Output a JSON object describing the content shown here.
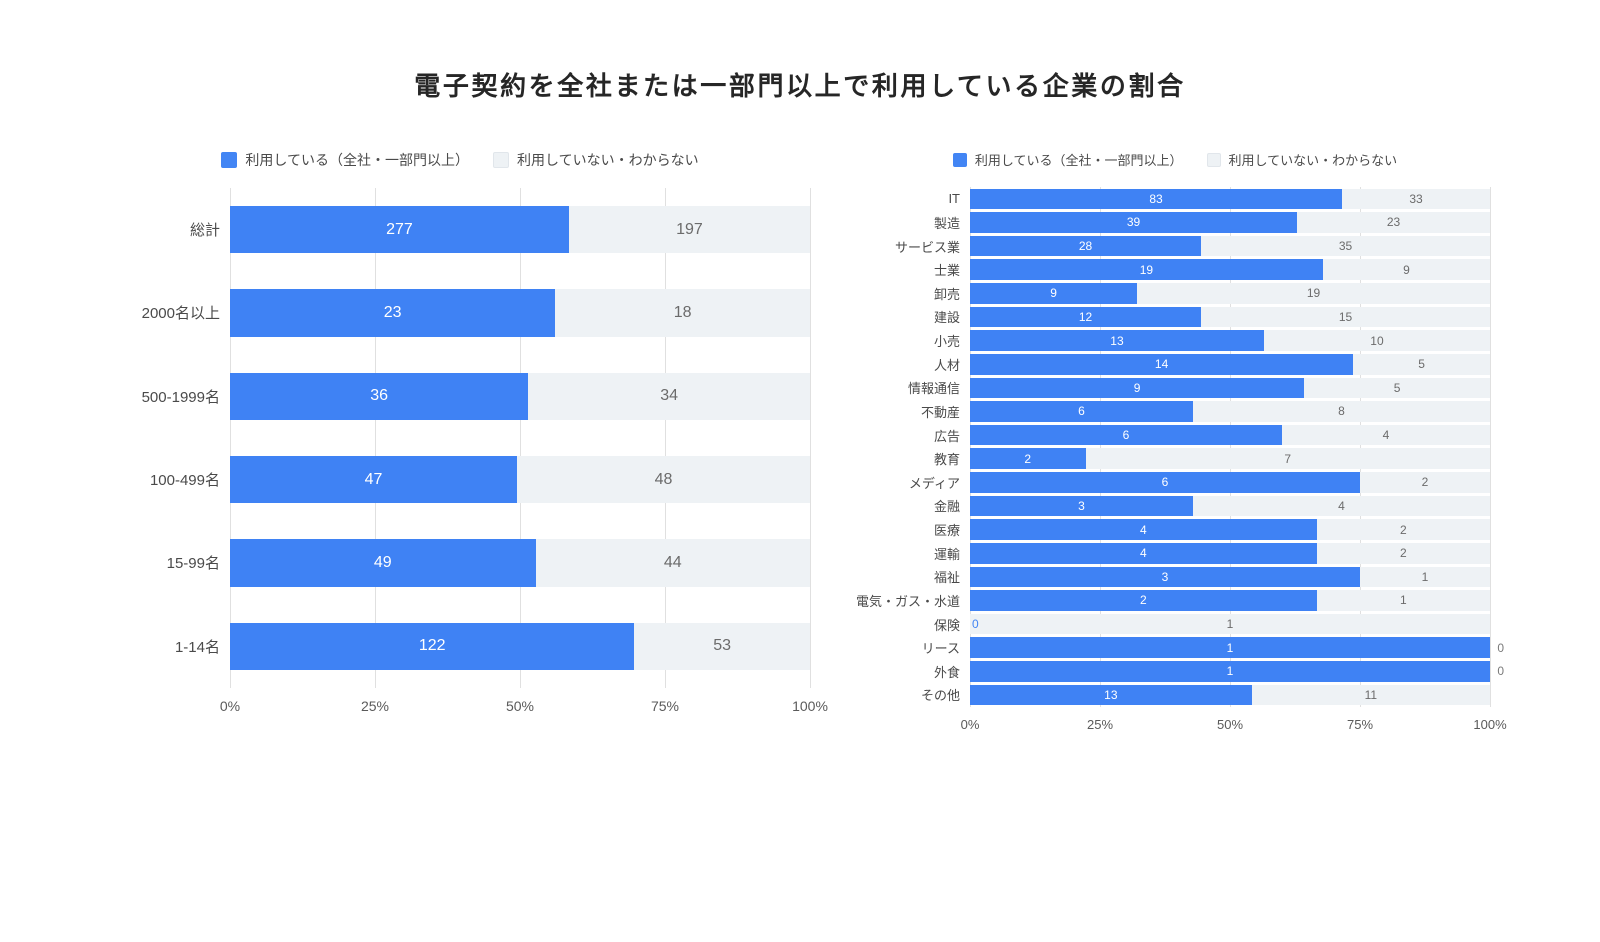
{
  "title": "電子契約を全社または一部門以上で利用している企業の割合",
  "legend": {
    "using": "利用している（全社・一部門以上）",
    "not_using": "利用していない・わからない"
  },
  "xticks": [
    "0%",
    "25%",
    "50%",
    "75%",
    "100%"
  ],
  "chart_data": [
    {
      "type": "bar",
      "orientation": "horizontal-stacked-100pct",
      "title": "by company size",
      "xlabel": "",
      "ylabel": "",
      "xlim": [
        0,
        100
      ],
      "xtick_labels": [
        "0%",
        "25%",
        "50%",
        "75%",
        "100%"
      ],
      "categories": [
        "総計",
        "2000名以上",
        "500-1999名",
        "100-499名",
        "15-99名",
        "1-14名"
      ],
      "series": [
        {
          "name": "利用している（全社・一部門以上）",
          "color": "#3f82f4",
          "values": [
            277,
            23,
            36,
            47,
            49,
            122
          ]
        },
        {
          "name": "利用していない・わからない",
          "color": "#eef2f5",
          "values": [
            197,
            18,
            34,
            48,
            44,
            53
          ]
        }
      ]
    },
    {
      "type": "bar",
      "orientation": "horizontal-stacked-100pct",
      "title": "by industry",
      "xlabel": "",
      "ylabel": "",
      "xlim": [
        0,
        100
      ],
      "xtick_labels": [
        "0%",
        "25%",
        "50%",
        "75%",
        "100%"
      ],
      "categories": [
        "IT",
        "製造",
        "サービス業",
        "士業",
        "卸売",
        "建設",
        "小売",
        "人材",
        "情報通信",
        "不動産",
        "広告",
        "教育",
        "メディア",
        "金融",
        "医療",
        "運輸",
        "福祉",
        "電気・ガス・水道",
        "保険",
        "リース",
        "外食",
        "その他"
      ],
      "series": [
        {
          "name": "利用している（全社・一部門以上）",
          "color": "#3f82f4",
          "values": [
            83,
            39,
            28,
            19,
            9,
            12,
            13,
            14,
            9,
            6,
            6,
            2,
            6,
            3,
            4,
            4,
            3,
            2,
            0,
            1,
            1,
            13
          ]
        },
        {
          "name": "利用していない・わからない",
          "color": "#eef2f5",
          "values": [
            33,
            23,
            35,
            9,
            19,
            15,
            10,
            5,
            5,
            8,
            4,
            7,
            2,
            4,
            2,
            2,
            1,
            1,
            1,
            0,
            0,
            11
          ]
        }
      ]
    }
  ]
}
